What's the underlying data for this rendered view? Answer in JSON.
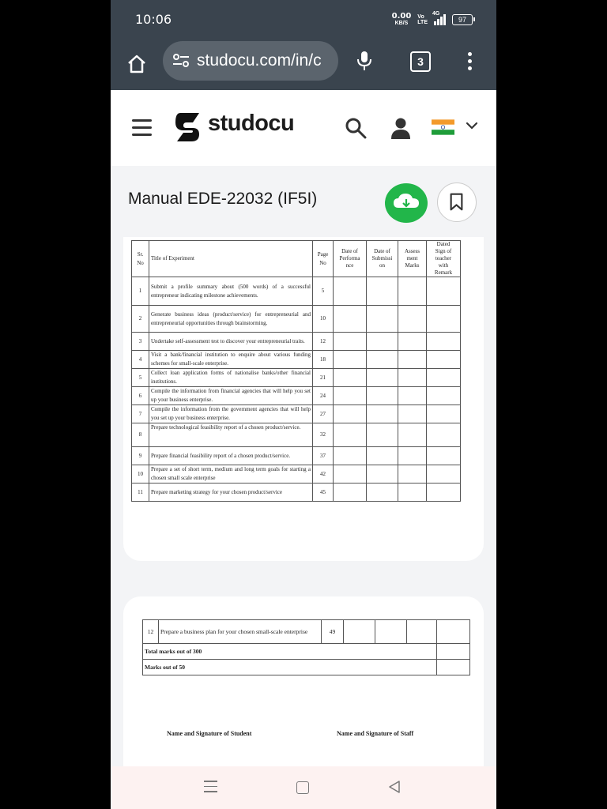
{
  "status_bar": {
    "time": "10:06",
    "net_speed_value": "0.00",
    "net_speed_unit": "KB/S",
    "volte_top": "Vo",
    "volte_bottom": "LTE",
    "network_type": "4G",
    "battery": "97"
  },
  "browser": {
    "url": "studocu.com/in/c",
    "tab_count": "3"
  },
  "site_header": {
    "brand_name": "studocu"
  },
  "document": {
    "title": "Manual EDE-22032 (IF5I)"
  },
  "table": {
    "headers": {
      "sr_no": "Sr.\nNo",
      "title": "Title of Experiment",
      "page_no": "Page\nNo",
      "date_performance": "Date of\nPerforma\nnce",
      "date_submission": "Date of\nSubmissi\non",
      "assessment_marks": "Assess\nment\nMarks",
      "dated_sign": "Dated\nSign of\nteacher\nwith\nRemark"
    },
    "rows": [
      {
        "no": "1",
        "title": "Submit a profile summary about (500 words) of a successful entrepreneur indicating milestone achievements.",
        "page": "5"
      },
      {
        "no": "2",
        "title": "Generate business ideas (product/service) for entrepreneurial and entrepreneurial opportunities through brainstorming.",
        "page": "10"
      },
      {
        "no": "3",
        "title": "Undertake self-assessment test to discover your entrepreneurial traits.",
        "page": "12"
      },
      {
        "no": "4",
        "title": "Visit a bank/financial institution to enquire about various funding schemes for small-scale enterprise.",
        "page": "18"
      },
      {
        "no": "5",
        "title": "Collect loan application forms of nationalise banks/other financial institutions.",
        "page": "21"
      },
      {
        "no": "6",
        "title": "Compile the information from financial agencies that will help you set up your business enterprise.",
        "page": "24"
      },
      {
        "no": "7",
        "title": "Compile the information from the government agencies that will help you set up your business enterprise.",
        "page": "27"
      },
      {
        "no": "8",
        "title": "Prepare technological feasibility report of a chosen product/service.",
        "page": "32"
      },
      {
        "no": "9",
        "title": "Prepare financial feasibility report of a chosen product/service.",
        "page": "37"
      },
      {
        "no": "10",
        "title": "Prepare a set of short term, medium and long term goals for starting a chosen small scale enterprise",
        "page": "42"
      },
      {
        "no": "11",
        "title": "Prepare marketing strategy for your chosen product/service",
        "page": "45"
      }
    ],
    "row12": {
      "no": "12",
      "title": "Prepare a business plan for your chosen small-scale enterprise",
      "page": "49"
    },
    "total_300": "Total marks out of 300",
    "marks_50": "Marks out of 50"
  },
  "signatures": {
    "student": "Name and Signature of Student",
    "staff": "Name and Signature of Staff"
  },
  "colors": {
    "status_bar_bg": "#3a444e",
    "download_green": "#22b64a"
  }
}
